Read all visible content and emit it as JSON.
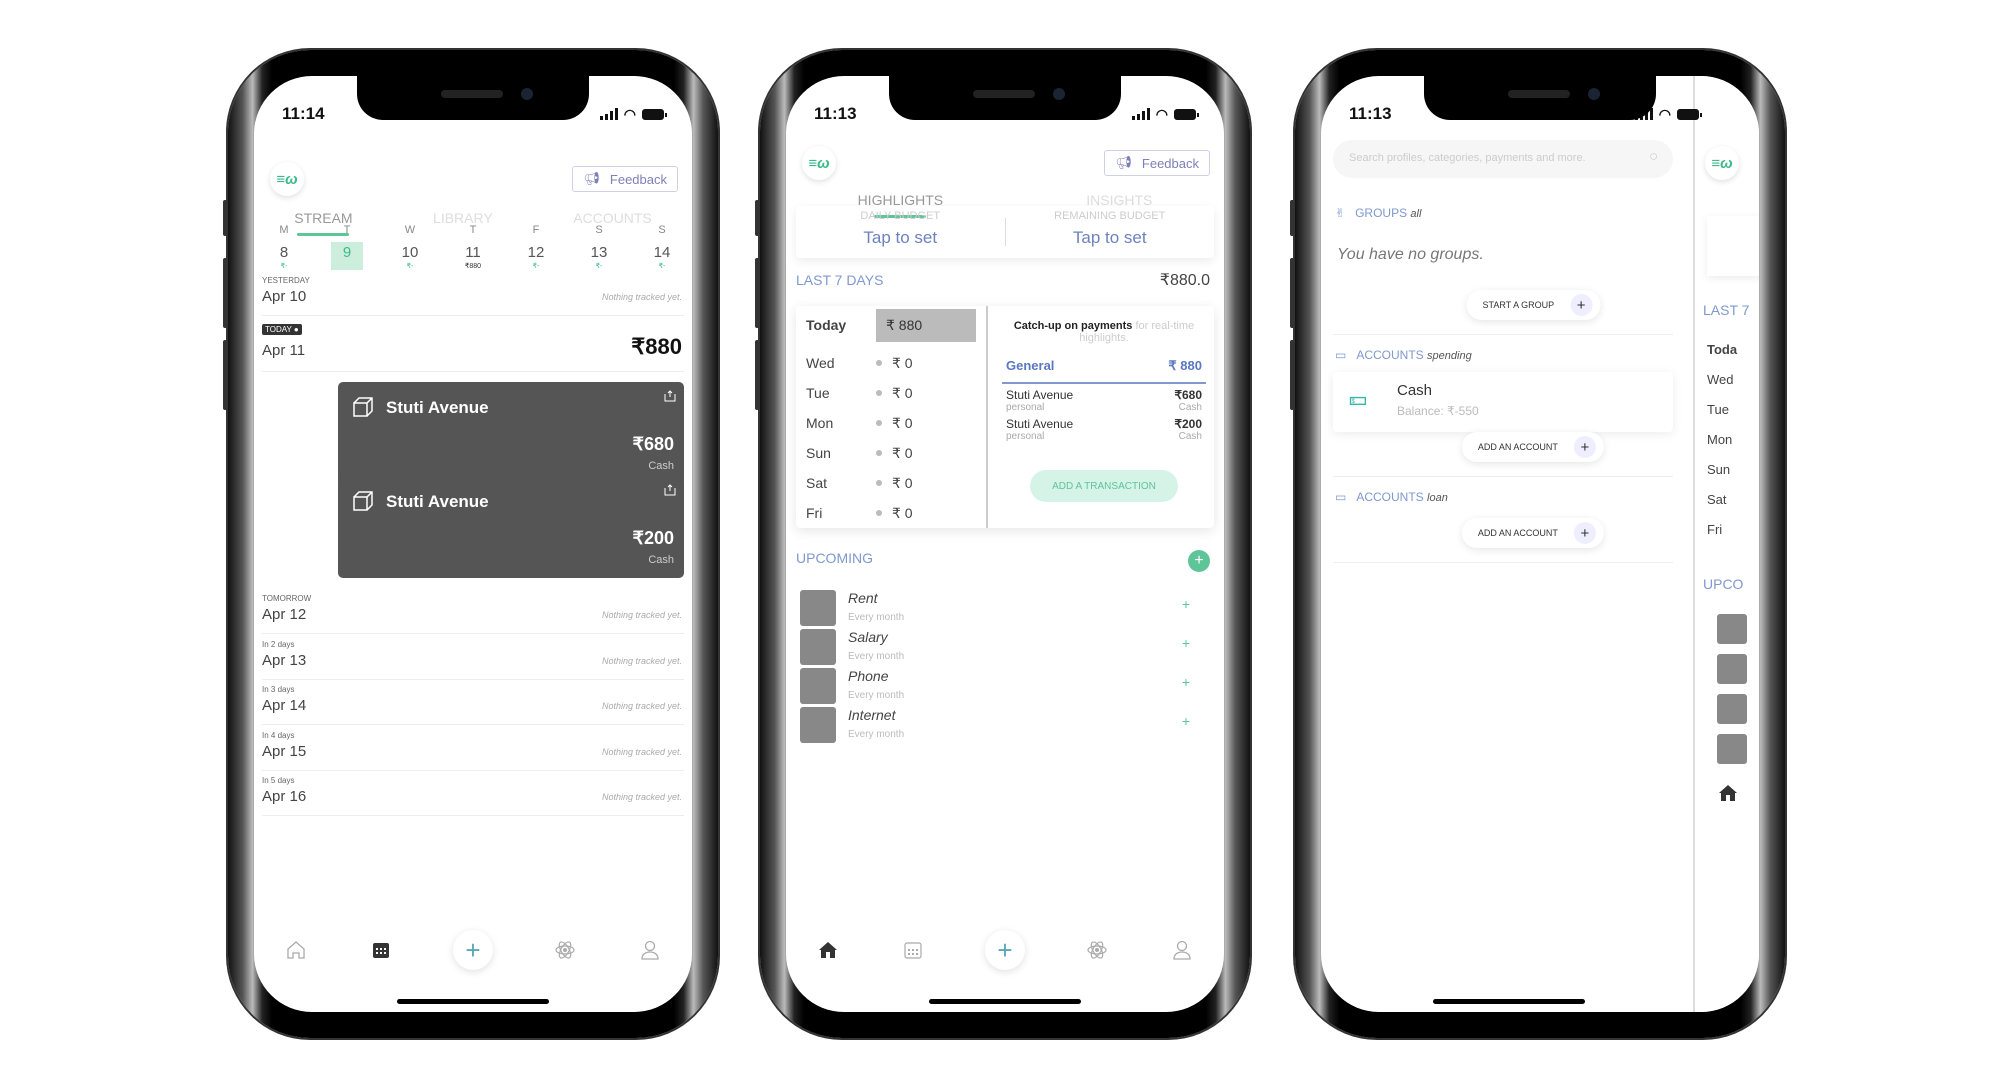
{
  "phones": [
    {
      "status": {
        "time": "11:14"
      },
      "feedback_label": "Feedback",
      "tabs": [
        "STREAM",
        "LIBRARY",
        "ACCOUNTS"
      ],
      "week": [
        {
          "day": "M",
          "date": "8",
          "sub": "₹-"
        },
        {
          "day": "T",
          "date": "9",
          "sub": "",
          "selected": true
        },
        {
          "day": "W",
          "date": "10",
          "sub": "₹-"
        },
        {
          "day": "T",
          "date": "11",
          "sub": "₹880"
        },
        {
          "day": "F",
          "date": "12",
          "sub": "₹-"
        },
        {
          "day": "S",
          "date": "13",
          "sub": "₹-"
        },
        {
          "day": "S",
          "date": "14",
          "sub": "₹-"
        }
      ],
      "yesterday": {
        "label": "YESTERDAY",
        "date": "Apr 10",
        "note": "Nothing tracked yet."
      },
      "today": {
        "badge": "TODAY ●",
        "date": "Apr 11",
        "total": "₹880"
      },
      "transactions": [
        {
          "title": "Stuti Avenue",
          "amount": "₹680",
          "account": "Cash"
        },
        {
          "title": "Stuti Avenue",
          "amount": "₹200",
          "account": "Cash"
        }
      ],
      "upcoming_days": [
        {
          "label": "TOMORROW",
          "date": "Apr 12",
          "note": "Nothing tracked yet."
        },
        {
          "label": "In 2 days",
          "date": "Apr 13",
          "note": "Nothing tracked yet."
        },
        {
          "label": "In 3 days",
          "date": "Apr 14",
          "note": "Nothing tracked yet."
        },
        {
          "label": "In 4 days",
          "date": "Apr 15",
          "note": "Nothing tracked yet."
        },
        {
          "label": "In 5 days",
          "date": "Apr 16",
          "note": "Nothing tracked yet."
        }
      ]
    },
    {
      "status": {
        "time": "11:13"
      },
      "feedback_label": "Feedback",
      "tabs": [
        "HIGHLIGHTS",
        "INSIGHTS"
      ],
      "budget": {
        "daily_label": "DAILY BUDGET",
        "daily_value": "Tap to set",
        "remaining_label": "REMAINING BUDGET",
        "remaining_value": "Tap to set"
      },
      "last7": {
        "title": "LAST 7 DAYS",
        "total": "₹880.0",
        "days": [
          {
            "day": "Today",
            "amount": "₹ 880"
          },
          {
            "day": "Wed",
            "amount": "₹ 0"
          },
          {
            "day": "Tue",
            "amount": "₹ 0"
          },
          {
            "day": "Mon",
            "amount": "₹ 0"
          },
          {
            "day": "Sun",
            "amount": "₹ 0"
          },
          {
            "day": "Sat",
            "amount": "₹ 0"
          },
          {
            "day": "Fri",
            "amount": "₹ 0"
          }
        ],
        "catchup_strong": "Catch-up on payments",
        "catchup_rest": " for real-time highlights.",
        "category": "General",
        "category_total": "₹ 880",
        "transactions": [
          {
            "name": "Stuti Avenue",
            "tag": "personal",
            "amount": "₹680",
            "account": "Cash"
          },
          {
            "name": "Stuti Avenue",
            "tag": "personal",
            "amount": "₹200",
            "account": "Cash"
          }
        ],
        "add_label": "ADD A TRANSACTION"
      },
      "upcoming": {
        "title": "UPCOMING",
        "items": [
          {
            "name": "Rent",
            "freq": "Every month",
            "icon": "house-icon"
          },
          {
            "name": "Salary",
            "freq": "Every month",
            "icon": "inbox-download-icon"
          },
          {
            "name": "Phone",
            "freq": "Every month",
            "icon": "house-icon"
          },
          {
            "name": "Internet",
            "freq": "Every month",
            "icon": "store-icon"
          }
        ]
      }
    },
    {
      "status": {
        "time": "11:13"
      },
      "search_placeholder": "Search profiles, categories, payments and more.",
      "groups": {
        "title": "GROUPS",
        "qualifier": "all",
        "empty": "You have no groups.",
        "button": "START A GROUP"
      },
      "accounts_spending": {
        "title": "ACCOUNTS",
        "qualifier": "spending",
        "account_name": "Cash",
        "balance": "Balance: ₹-550",
        "button": "ADD AN ACCOUNT"
      },
      "accounts_loan": {
        "title": "ACCOUNTS",
        "qualifier": "loan",
        "button": "ADD AN ACCOUNT"
      },
      "peek": {
        "section": "LAST 7",
        "days": [
          "Toda",
          "Wed",
          "Tue",
          "Mon",
          "Sun",
          "Sat",
          "Fri"
        ],
        "upcoming": "UPCO"
      }
    }
  ],
  "colors": {
    "accent_green": "#5ec599",
    "accent_blue": "#7f98cd",
    "card_dark": "#555555"
  }
}
